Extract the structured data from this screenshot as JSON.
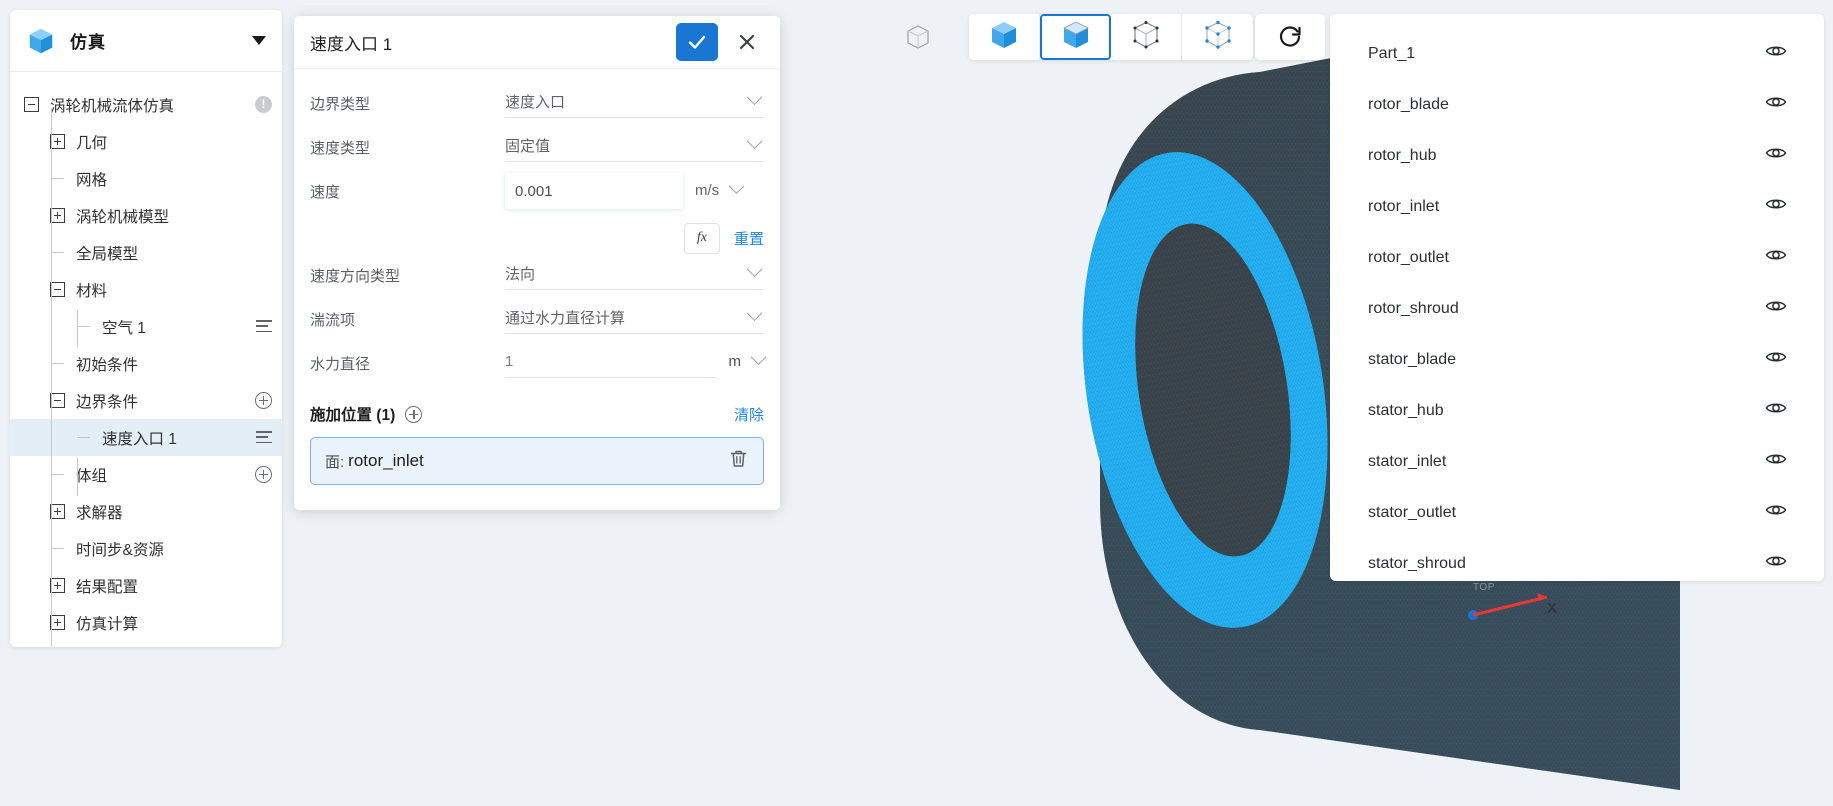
{
  "sidebar": {
    "logo_icon": "cube-icon",
    "title": "仿真",
    "collapse_icon": "caret-down-icon",
    "tree": [
      {
        "label": "涡轮机械流体仿真",
        "toggle": "minus",
        "depth": 0,
        "right_icon": "warning-badge",
        "selected": false
      },
      {
        "label": "几何",
        "toggle": "plus",
        "depth": 1,
        "right_icon": "",
        "selected": false
      },
      {
        "label": "网格",
        "toggle": "leaf",
        "depth": 1,
        "right_icon": "",
        "selected": false
      },
      {
        "label": "涡轮机械模型",
        "toggle": "plus",
        "depth": 1,
        "right_icon": "",
        "selected": false
      },
      {
        "label": "全局模型",
        "toggle": "leaf",
        "depth": 1,
        "right_icon": "",
        "selected": false
      },
      {
        "label": "材料",
        "toggle": "minus",
        "depth": 1,
        "right_icon": "",
        "selected": false
      },
      {
        "label": "空气 1",
        "toggle": "leaf",
        "depth": 2,
        "right_icon": "list-icon",
        "selected": false
      },
      {
        "label": "初始条件",
        "toggle": "leaf",
        "depth": 1,
        "right_icon": "",
        "selected": false
      },
      {
        "label": "边界条件",
        "toggle": "minus",
        "depth": 1,
        "right_icon": "plus-circle",
        "selected": false
      },
      {
        "label": "速度入口 1",
        "toggle": "leaf",
        "depth": 2,
        "right_icon": "list-icon",
        "selected": true
      },
      {
        "label": "体组",
        "toggle": "leaf",
        "depth": 1,
        "right_icon": "plus-circle",
        "selected": false
      },
      {
        "label": "求解器",
        "toggle": "plus",
        "depth": 1,
        "right_icon": "",
        "selected": false
      },
      {
        "label": "时间步&资源",
        "toggle": "leaf",
        "depth": 1,
        "right_icon": "",
        "selected": false
      },
      {
        "label": "结果配置",
        "toggle": "plus",
        "depth": 1,
        "right_icon": "",
        "selected": false
      },
      {
        "label": "仿真计算",
        "toggle": "plus",
        "depth": 1,
        "right_icon": "",
        "selected": false
      }
    ]
  },
  "dialog": {
    "title": "速度入口 1",
    "confirm_icon": "check-icon",
    "cancel_icon": "close-icon",
    "fields": [
      {
        "label": "边界类型",
        "value": "速度入口",
        "kind": "select"
      },
      {
        "label": "速度类型",
        "value": "固定值",
        "kind": "select"
      },
      {
        "label": "速度",
        "value": "0.001",
        "kind": "input",
        "unit": "m/s"
      },
      {
        "label": "速度方向类型",
        "value": "法向",
        "kind": "select"
      },
      {
        "label": "湍流项",
        "value": "通过水力直径计算",
        "kind": "select"
      },
      {
        "label": "水力直径",
        "value": "1",
        "kind": "plain",
        "unit": "m"
      }
    ],
    "fx_label": "fx",
    "reset_label": "重置",
    "apply_title": "施加位置 (1)",
    "apply_add_icon": "plus-circle-icon",
    "clear_label": "清除",
    "chip": {
      "prefix": "面:",
      "name": "rotor_inlet",
      "delete_icon": "trash-icon"
    }
  },
  "toolbar": {
    "single_icon": "wireframe-cube-icon",
    "buttons": [
      {
        "icon": "solid-cube-icon",
        "active": false
      },
      {
        "icon": "shaded-cube-icon",
        "active": true
      },
      {
        "icon": "wireframe-cube-icon",
        "active": false
      },
      {
        "icon": "points-cube-icon",
        "active": false
      }
    ],
    "reset_icon": "rotate-reset-icon"
  },
  "parts_panel": {
    "visibility_icon": "eye-icon",
    "items": [
      {
        "name": "Part_1"
      },
      {
        "name": "rotor_blade"
      },
      {
        "name": "rotor_hub"
      },
      {
        "name": "rotor_inlet"
      },
      {
        "name": "rotor_outlet"
      },
      {
        "name": "rotor_shroud"
      },
      {
        "name": "stator_blade"
      },
      {
        "name": "stator_hub"
      },
      {
        "name": "stator_inlet"
      },
      {
        "name": "stator_outlet"
      },
      {
        "name": "stator_shroud"
      }
    ]
  },
  "viewport": {
    "triad_top_label": "TOP",
    "triad_x_label": "X"
  },
  "colors": {
    "accent": "#1976d2",
    "link": "#1e88e5",
    "selection_bg": "#e4eef7",
    "mesh_highlight": "#29b6f6",
    "mesh_body": "#3c4044",
    "page_bg": "#eef1f5"
  }
}
